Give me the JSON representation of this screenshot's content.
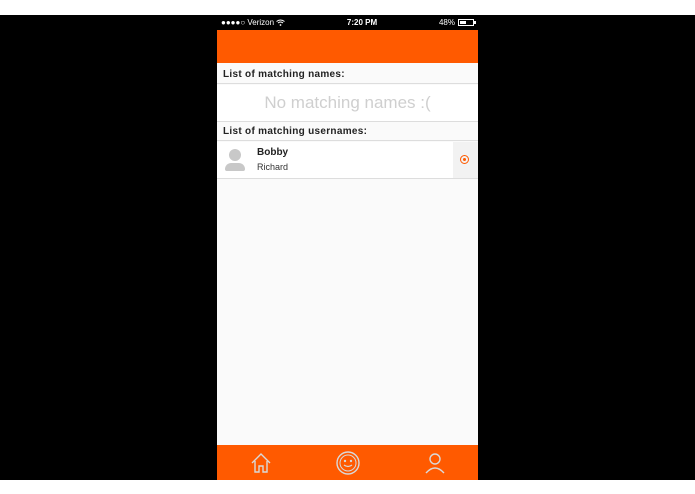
{
  "status_bar": {
    "carrier": "●●●●○ Verizon",
    "time": "7:20 PM",
    "battery": "48%",
    "battery_level": 0.48
  },
  "sections": {
    "names_title": "List of matching names:",
    "names_empty": "No matching names :(",
    "usernames_title": "List of matching usernames:"
  },
  "users": [
    {
      "first_name": "Bobby",
      "last_name": "Richard"
    }
  ],
  "tab_bar": {
    "tabs": [
      {
        "icon": "home-icon"
      },
      {
        "icon": "smiley-icon"
      },
      {
        "icon": "profile-icon"
      }
    ]
  },
  "colors": {
    "accent": "#ff5a00",
    "background": "#fafafa"
  }
}
